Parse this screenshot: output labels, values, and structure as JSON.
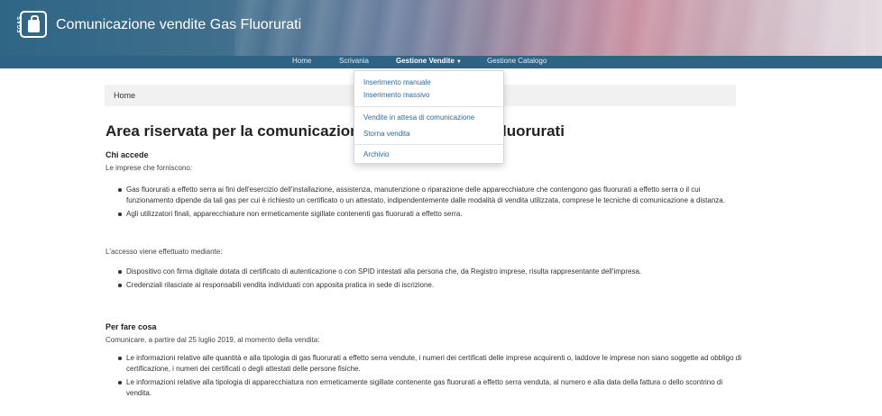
{
  "app": {
    "title": "Comunicazione vendite Gas Fluorurati",
    "logo_text": "FGAS"
  },
  "nav": {
    "items": [
      {
        "label": "Home",
        "active": false
      },
      {
        "label": "Scrivania",
        "active": false
      },
      {
        "label": "Gestione Vendite",
        "active": true,
        "caret": "▼"
      },
      {
        "label": "Gestione Catalogo",
        "active": false
      }
    ]
  },
  "dropdown": {
    "items": [
      "Inserimento manuale",
      "Inserimento massivo",
      "Vendite in attesa di comunicazione",
      "Storna vendita",
      "Archivio"
    ]
  },
  "breadcrumb": {
    "home": "Home"
  },
  "content": {
    "title": "Area riservata per la comunicazione delle vendite di gas fluorurati",
    "title_visible_left": "Area riservata per la comunicazione",
    "title_visible_right": "luorurati",
    "chi_accede": {
      "heading": "Chi accede",
      "intro": "Le imprese che forniscono:",
      "bullets": [
        "Gas fluorurati a effetto serra ai fini dell'esercizio dell'installazione, assistenza, manutenzione o riparazione delle apparecchiature che contengono gas fluorurati a effetto serra o il cui funzionamento dipende da tali gas per cui è richiesto un certificato o un attestato, indipendentemente dalle modalità di vendita utilizzata, comprese le tecniche di comunicazione a distanza.",
        "Agli utilizzatori finali, apparecchiature non ermeticamente sigillate contenenti gas fluorurati a effetto serra."
      ]
    },
    "accesso": {
      "intro": "L'accesso viene effettuato mediante:",
      "bullets": [
        "Dispositivo con firma digitale dotata di certificato di autenticazione o con SPID intestati alla persona che, da Registro imprese, risulta rappresentante dell'impresa.",
        "Credenziali rilasciate ai responsabili vendita individuati con apposita pratica in sede di iscrizione."
      ]
    },
    "per_fare_cosa": {
      "heading": "Per fare cosa",
      "intro": "Comunicare, a partire dal 25 luglio 2019, al momento della vendita:",
      "bullets": [
        "Le informazioni relative alle quantità e alla tipologia di gas fluorurati a effetto serra vendute, i numeri dei certificati delle imprese acquirenti o, laddove le imprese non siano soggette ad obbligo di certificazione, i numeri dei certificati o degli attestati delle persone fisiche.",
        "Le informazioni relative alla tipologia di apparecchiatura non ermeticamente sigillate contenente gas fluorurati a effetto serra venduta, al numero e alla data della fattura o dello scontrino di vendita."
      ]
    }
  }
}
